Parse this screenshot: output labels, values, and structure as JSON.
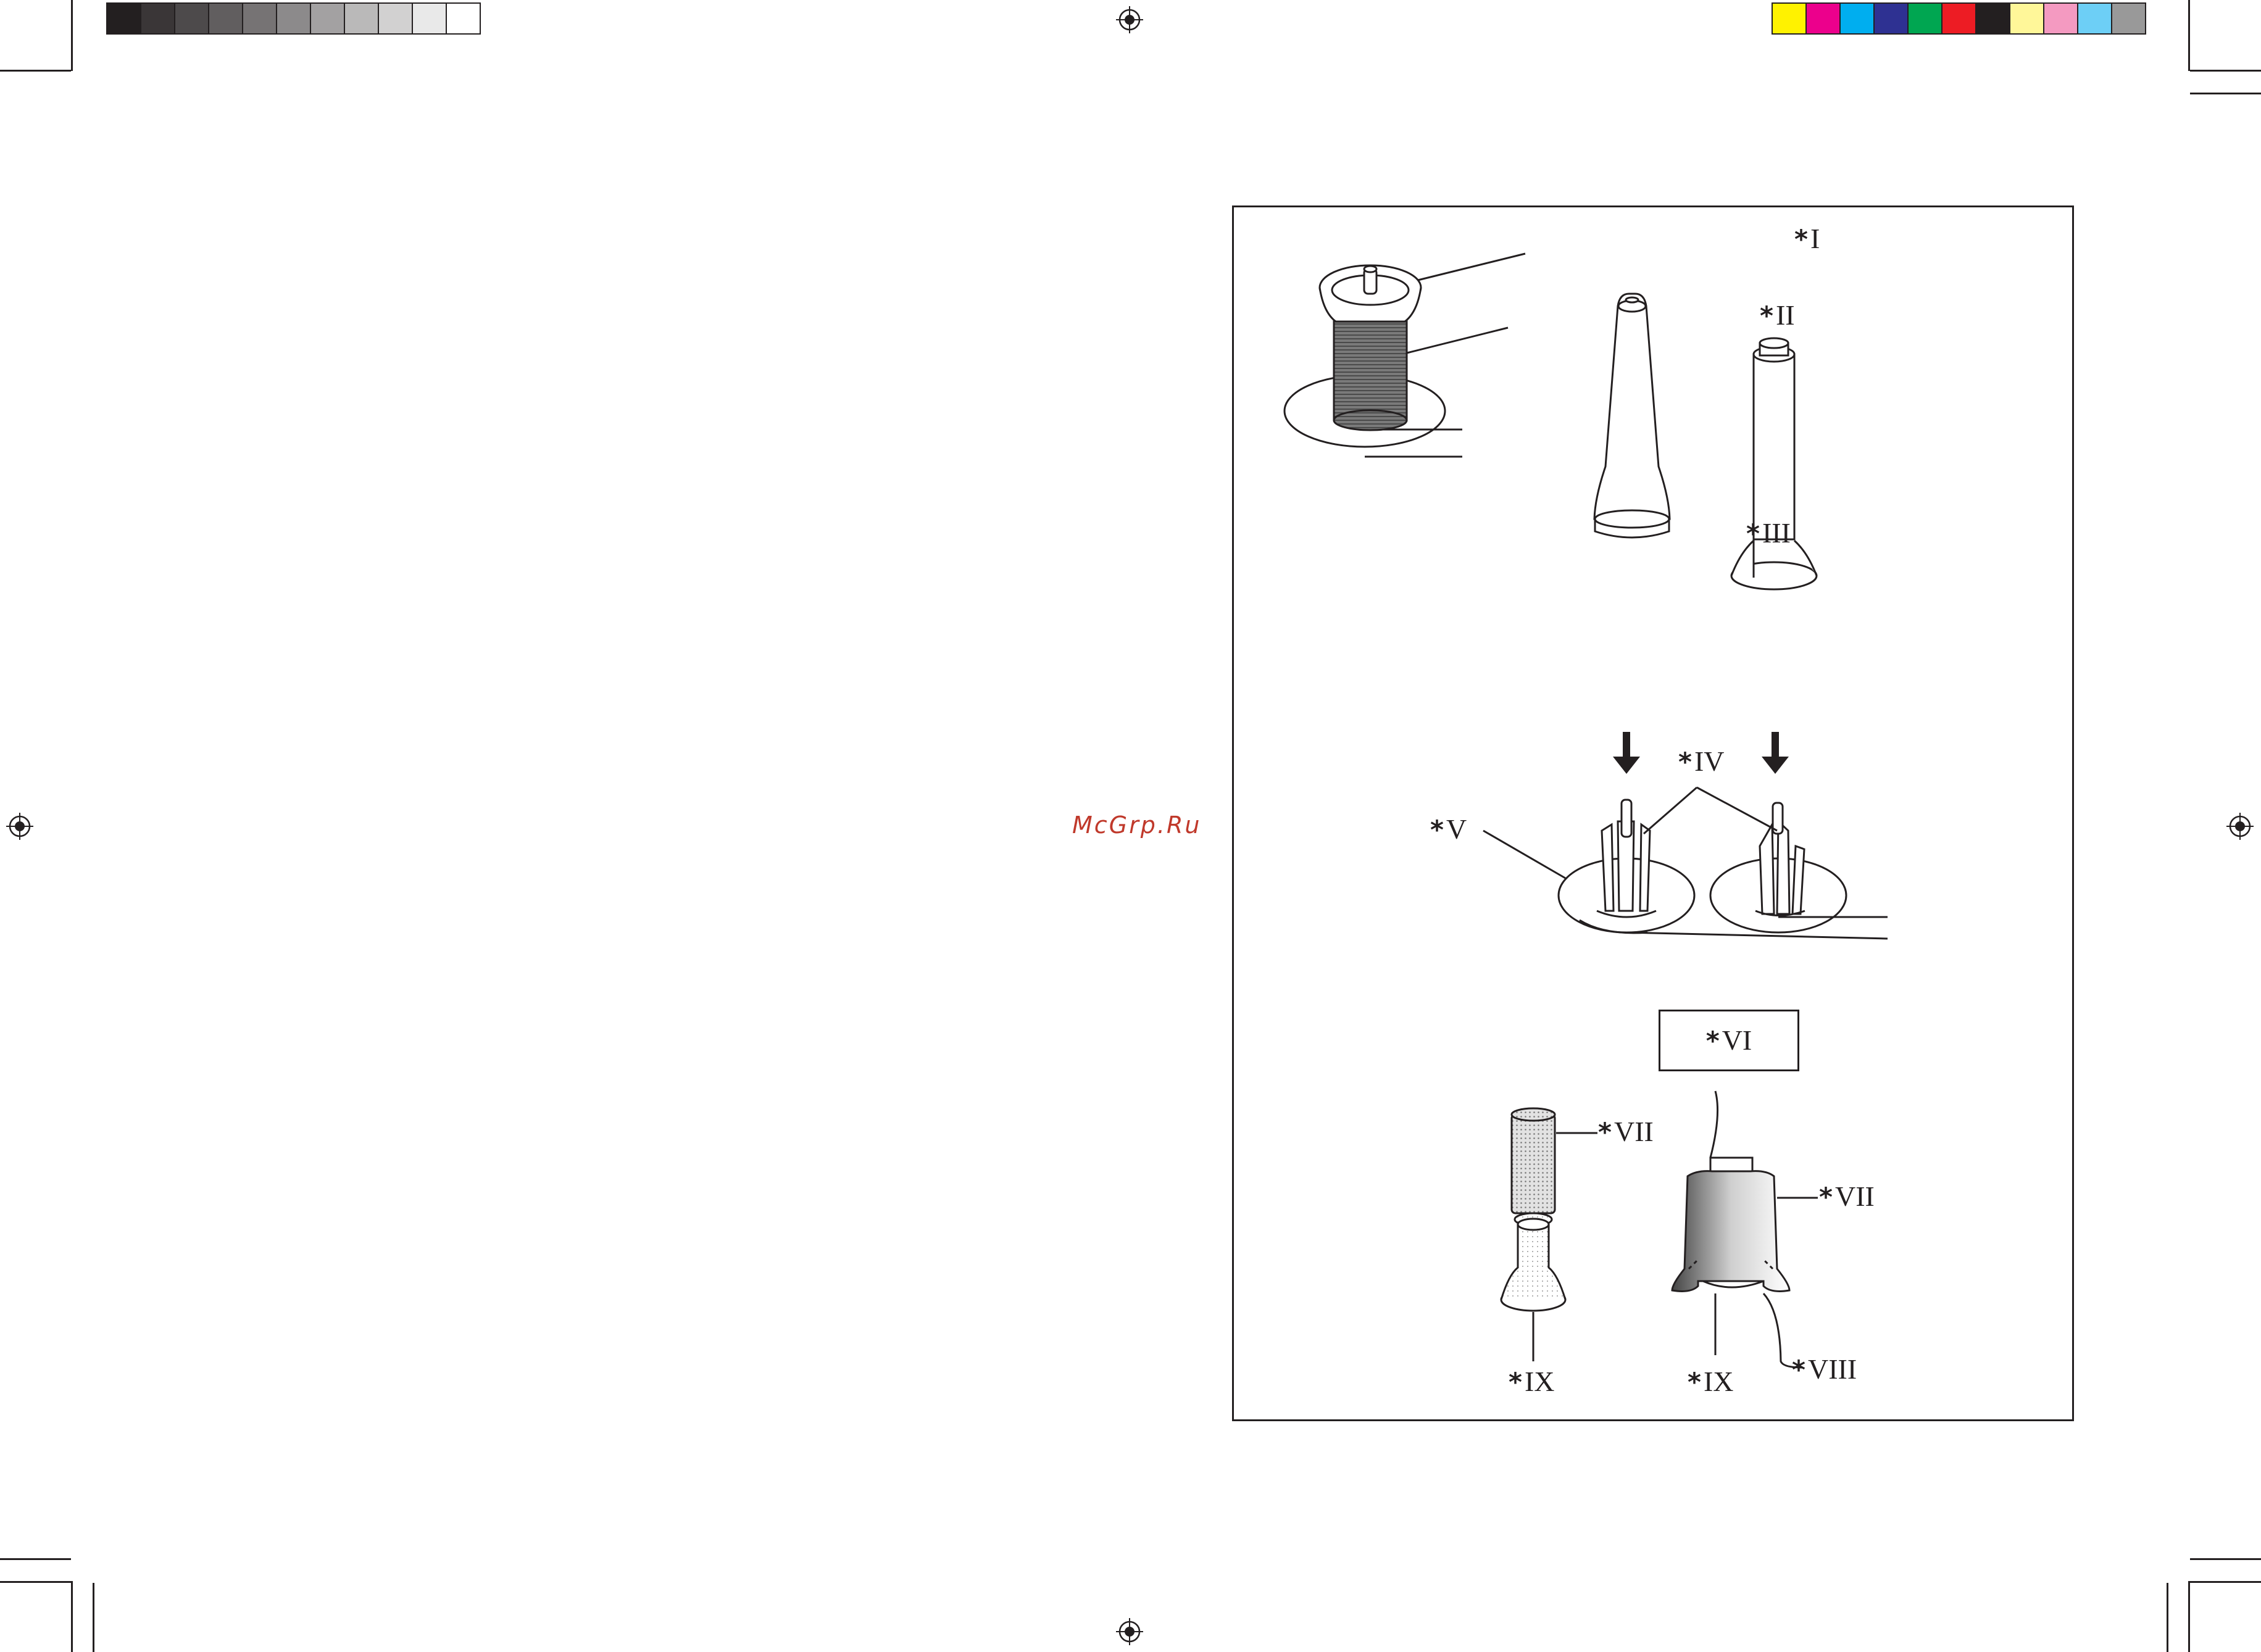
{
  "print_marks": {
    "grayscale_swatches": [
      "#231f20",
      "#3a3637",
      "#4d4a4b",
      "#615e5f",
      "#767374",
      "#8c8a8b",
      "#a3a1a2",
      "#bab9b9",
      "#d2d1d1",
      "#e9e9e9",
      "#ffffff"
    ],
    "color_swatches": [
      "#fff200",
      "#ec008c",
      "#00aeef",
      "#2e3192",
      "#00a651",
      "#ed1c24",
      "#231f20",
      "#fff799",
      "#f49ac1",
      "#6dcff6",
      "#999999"
    ]
  },
  "watermark": {
    "text": "McGrp.Ru"
  },
  "figure": {
    "callouts": {
      "I": "I",
      "II": "II",
      "III": "III",
      "IV": "IV",
      "V": "V",
      "VI": "VI",
      "VII_left": "VII",
      "VII_right": "VII",
      "VIII": "VIII",
      "IX_left": "IX",
      "IX_right": "IX"
    },
    "star": "*"
  }
}
